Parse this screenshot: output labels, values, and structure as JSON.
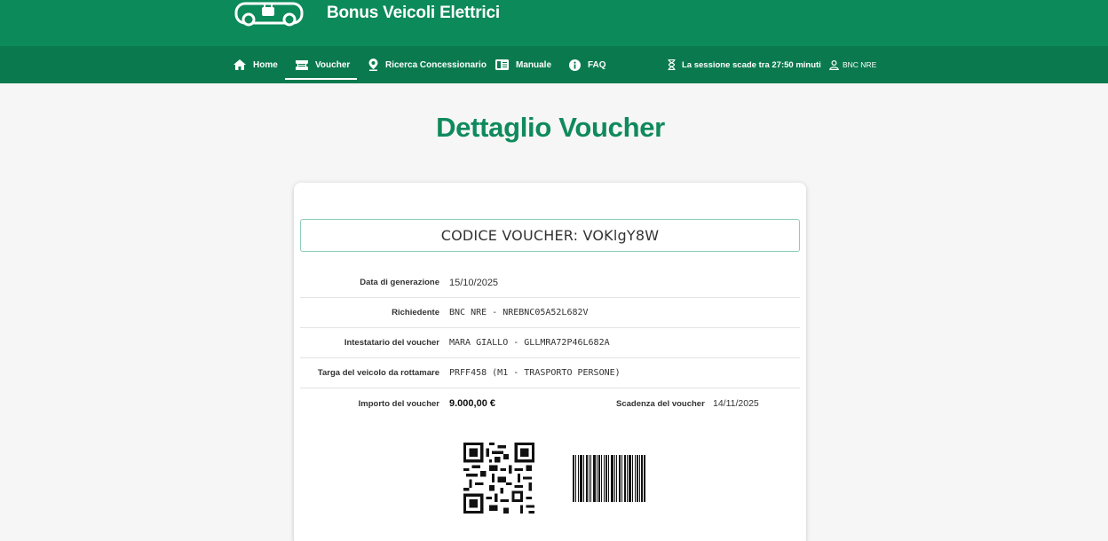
{
  "header": {
    "brand": "Bonus Veicoli Elettrici",
    "logo_icon": "electric-car-plug-icon"
  },
  "nav": {
    "items": [
      {
        "label": "Home",
        "icon": "home-icon",
        "active": false
      },
      {
        "label": "Voucher",
        "icon": "ticket-icon",
        "active": true
      },
      {
        "label": "Ricerca Concessionario",
        "icon": "map-pin-icon",
        "active": false
      },
      {
        "label": "Manuale",
        "icon": "book-icon",
        "active": false
      },
      {
        "label": "FAQ",
        "icon": "info-icon",
        "active": false
      }
    ],
    "session_text": "La sessione scade tra 27:50 minuti",
    "user": "BNC NRE"
  },
  "page": {
    "title": "Dettaglio Voucher"
  },
  "voucher": {
    "code_text": "CODICE VOUCHER: VOKlgY8W",
    "details": [
      {
        "label": "Data di generazione",
        "value": "15/10/2025"
      },
      {
        "label": "Richiedente",
        "value": "BNC NRE - NREBNC05A52L682V"
      },
      {
        "label": "Intestatario del voucher",
        "value": "MARA GIALLO - GLLMRA72P46L682A"
      },
      {
        "label": "Targa del veicolo da rottamare",
        "value": "PRFF458 (M1 - TRASPORTO PERSONE)"
      }
    ],
    "amount_label": "Importo del voucher",
    "amount_value": "9.000,00 €",
    "expiry_label": "Scadenza del voucher",
    "expiry_value": "14/11/2025"
  },
  "colors": {
    "header_green": "#0d8a5a",
    "nav_green": "#0a7a4e",
    "title_green": "#0f8a5c",
    "code_border": "#8fcdb5"
  }
}
